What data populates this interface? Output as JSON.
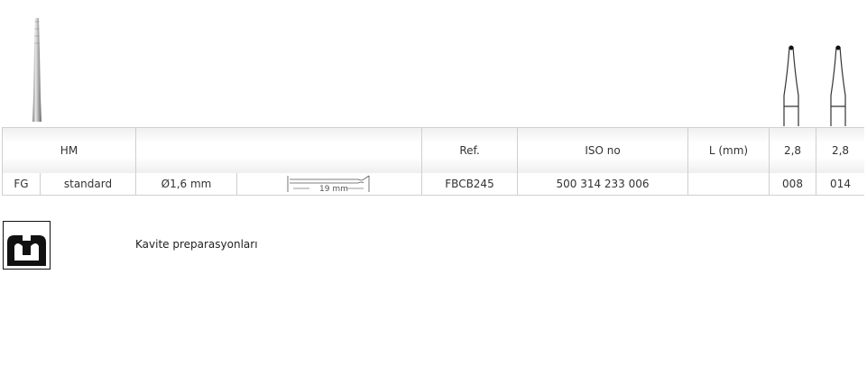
{
  "header": {
    "material": "HM",
    "ref": "Ref.",
    "iso": "ISO no",
    "length": "L (mm)",
    "size_1": "2,8",
    "size_2": "2,8"
  },
  "row": {
    "shank": "FG",
    "type": "standard",
    "diameter": "Ø1,6 mm",
    "shaft_length": "19 mm",
    "ref": "FBCB245",
    "iso": "500 314 233 006",
    "length": "",
    "code_1": "008",
    "code_2": "014"
  },
  "legend": {
    "label": "Kavite preparasyonları",
    "icon": "cavity-preparation-icon"
  }
}
